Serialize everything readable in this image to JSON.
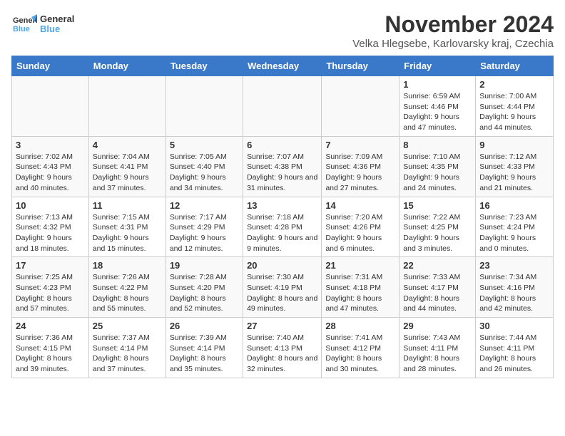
{
  "app": {
    "name": "GeneralBlue",
    "name_line1": "General",
    "name_line2": "Blue"
  },
  "header": {
    "month": "November 2024",
    "location": "Velka Hlegsebe, Karlovarsky kraj, Czechia"
  },
  "days_of_week": [
    "Sunday",
    "Monday",
    "Tuesday",
    "Wednesday",
    "Thursday",
    "Friday",
    "Saturday"
  ],
  "weeks": [
    {
      "cells": [
        {
          "empty": true
        },
        {
          "empty": true
        },
        {
          "empty": true
        },
        {
          "empty": true
        },
        {
          "empty": true
        },
        {
          "day": "1",
          "sunrise": "Sunrise: 6:59 AM",
          "sunset": "Sunset: 4:46 PM",
          "daylight": "Daylight: 9 hours and 47 minutes."
        },
        {
          "day": "2",
          "sunrise": "Sunrise: 7:00 AM",
          "sunset": "Sunset: 4:44 PM",
          "daylight": "Daylight: 9 hours and 44 minutes."
        }
      ]
    },
    {
      "cells": [
        {
          "day": "3",
          "sunrise": "Sunrise: 7:02 AM",
          "sunset": "Sunset: 4:43 PM",
          "daylight": "Daylight: 9 hours and 40 minutes."
        },
        {
          "day": "4",
          "sunrise": "Sunrise: 7:04 AM",
          "sunset": "Sunset: 4:41 PM",
          "daylight": "Daylight: 9 hours and 37 minutes."
        },
        {
          "day": "5",
          "sunrise": "Sunrise: 7:05 AM",
          "sunset": "Sunset: 4:40 PM",
          "daylight": "Daylight: 9 hours and 34 minutes."
        },
        {
          "day": "6",
          "sunrise": "Sunrise: 7:07 AM",
          "sunset": "Sunset: 4:38 PM",
          "daylight": "Daylight: 9 hours and 31 minutes."
        },
        {
          "day": "7",
          "sunrise": "Sunrise: 7:09 AM",
          "sunset": "Sunset: 4:36 PM",
          "daylight": "Daylight: 9 hours and 27 minutes."
        },
        {
          "day": "8",
          "sunrise": "Sunrise: 7:10 AM",
          "sunset": "Sunset: 4:35 PM",
          "daylight": "Daylight: 9 hours and 24 minutes."
        },
        {
          "day": "9",
          "sunrise": "Sunrise: 7:12 AM",
          "sunset": "Sunset: 4:33 PM",
          "daylight": "Daylight: 9 hours and 21 minutes."
        }
      ]
    },
    {
      "cells": [
        {
          "day": "10",
          "sunrise": "Sunrise: 7:13 AM",
          "sunset": "Sunset: 4:32 PM",
          "daylight": "Daylight: 9 hours and 18 minutes."
        },
        {
          "day": "11",
          "sunrise": "Sunrise: 7:15 AM",
          "sunset": "Sunset: 4:31 PM",
          "daylight": "Daylight: 9 hours and 15 minutes."
        },
        {
          "day": "12",
          "sunrise": "Sunrise: 7:17 AM",
          "sunset": "Sunset: 4:29 PM",
          "daylight": "Daylight: 9 hours and 12 minutes."
        },
        {
          "day": "13",
          "sunrise": "Sunrise: 7:18 AM",
          "sunset": "Sunset: 4:28 PM",
          "daylight": "Daylight: 9 hours and 9 minutes."
        },
        {
          "day": "14",
          "sunrise": "Sunrise: 7:20 AM",
          "sunset": "Sunset: 4:26 PM",
          "daylight": "Daylight: 9 hours and 6 minutes."
        },
        {
          "day": "15",
          "sunrise": "Sunrise: 7:22 AM",
          "sunset": "Sunset: 4:25 PM",
          "daylight": "Daylight: 9 hours and 3 minutes."
        },
        {
          "day": "16",
          "sunrise": "Sunrise: 7:23 AM",
          "sunset": "Sunset: 4:24 PM",
          "daylight": "Daylight: 9 hours and 0 minutes."
        }
      ]
    },
    {
      "cells": [
        {
          "day": "17",
          "sunrise": "Sunrise: 7:25 AM",
          "sunset": "Sunset: 4:23 PM",
          "daylight": "Daylight: 8 hours and 57 minutes."
        },
        {
          "day": "18",
          "sunrise": "Sunrise: 7:26 AM",
          "sunset": "Sunset: 4:22 PM",
          "daylight": "Daylight: 8 hours and 55 minutes."
        },
        {
          "day": "19",
          "sunrise": "Sunrise: 7:28 AM",
          "sunset": "Sunset: 4:20 PM",
          "daylight": "Daylight: 8 hours and 52 minutes."
        },
        {
          "day": "20",
          "sunrise": "Sunrise: 7:30 AM",
          "sunset": "Sunset: 4:19 PM",
          "daylight": "Daylight: 8 hours and 49 minutes."
        },
        {
          "day": "21",
          "sunrise": "Sunrise: 7:31 AM",
          "sunset": "Sunset: 4:18 PM",
          "daylight": "Daylight: 8 hours and 47 minutes."
        },
        {
          "day": "22",
          "sunrise": "Sunrise: 7:33 AM",
          "sunset": "Sunset: 4:17 PM",
          "daylight": "Daylight: 8 hours and 44 minutes."
        },
        {
          "day": "23",
          "sunrise": "Sunrise: 7:34 AM",
          "sunset": "Sunset: 4:16 PM",
          "daylight": "Daylight: 8 hours and 42 minutes."
        }
      ]
    },
    {
      "cells": [
        {
          "day": "24",
          "sunrise": "Sunrise: 7:36 AM",
          "sunset": "Sunset: 4:15 PM",
          "daylight": "Daylight: 8 hours and 39 minutes."
        },
        {
          "day": "25",
          "sunrise": "Sunrise: 7:37 AM",
          "sunset": "Sunset: 4:14 PM",
          "daylight": "Daylight: 8 hours and 37 minutes."
        },
        {
          "day": "26",
          "sunrise": "Sunrise: 7:39 AM",
          "sunset": "Sunset: 4:14 PM",
          "daylight": "Daylight: 8 hours and 35 minutes."
        },
        {
          "day": "27",
          "sunrise": "Sunrise: 7:40 AM",
          "sunset": "Sunset: 4:13 PM",
          "daylight": "Daylight: 8 hours and 32 minutes."
        },
        {
          "day": "28",
          "sunrise": "Sunrise: 7:41 AM",
          "sunset": "Sunset: 4:12 PM",
          "daylight": "Daylight: 8 hours and 30 minutes."
        },
        {
          "day": "29",
          "sunrise": "Sunrise: 7:43 AM",
          "sunset": "Sunset: 4:11 PM",
          "daylight": "Daylight: 8 hours and 28 minutes."
        },
        {
          "day": "30",
          "sunrise": "Sunrise: 7:44 AM",
          "sunset": "Sunset: 4:11 PM",
          "daylight": "Daylight: 8 hours and 26 minutes."
        }
      ]
    }
  ]
}
